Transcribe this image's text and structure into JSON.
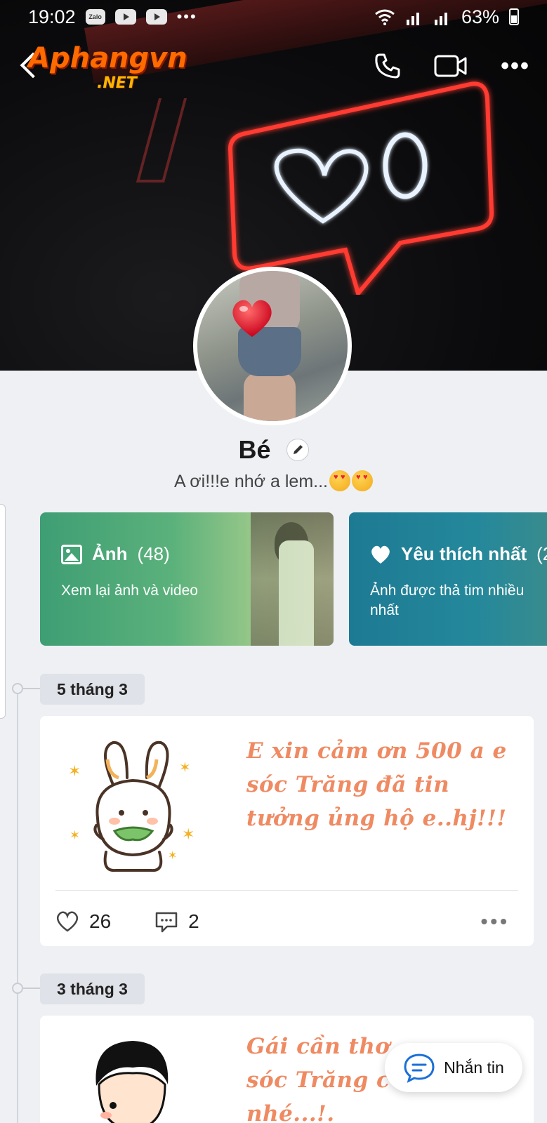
{
  "status_bar": {
    "time": "19:02",
    "app_icons": [
      "Zalo",
      "youtube-icon",
      "youtube-icon"
    ],
    "more": "•••",
    "battery": "63%"
  },
  "header": {
    "watermark": {
      "main": "Aphangvn",
      "sub": ".NET"
    }
  },
  "cover": {
    "neon_count": "0"
  },
  "profile": {
    "name": "Bé",
    "status": "A ơi!!!e nhớ a lem..."
  },
  "albums": [
    {
      "title": "Ảnh",
      "count": "(48)",
      "description": "Xem lại ảnh và video"
    },
    {
      "title": "Yêu thích nhất",
      "count": "(2",
      "description": "Ảnh được thả tim nhiều nhất"
    }
  ],
  "timeline": [
    {
      "date": "5 tháng 3",
      "text": "E xin cảm ơn 500 a e sóc Trăng đã tin tưởng ủng hộ e..hj!!!",
      "likes": "26",
      "comments": "2"
    },
    {
      "date": "3 tháng 3",
      "text": "Gái cần thơ\nsóc Trăng c\nnhé...!."
    }
  ],
  "message_button": {
    "label": "Nhắn tin"
  },
  "colors": {
    "green_card": "#3e9e74",
    "teal_card": "#1d7a93",
    "post_text": "#ef8a62",
    "neon_red": "#ff3b30",
    "accent_blue": "#1b6fd8"
  }
}
